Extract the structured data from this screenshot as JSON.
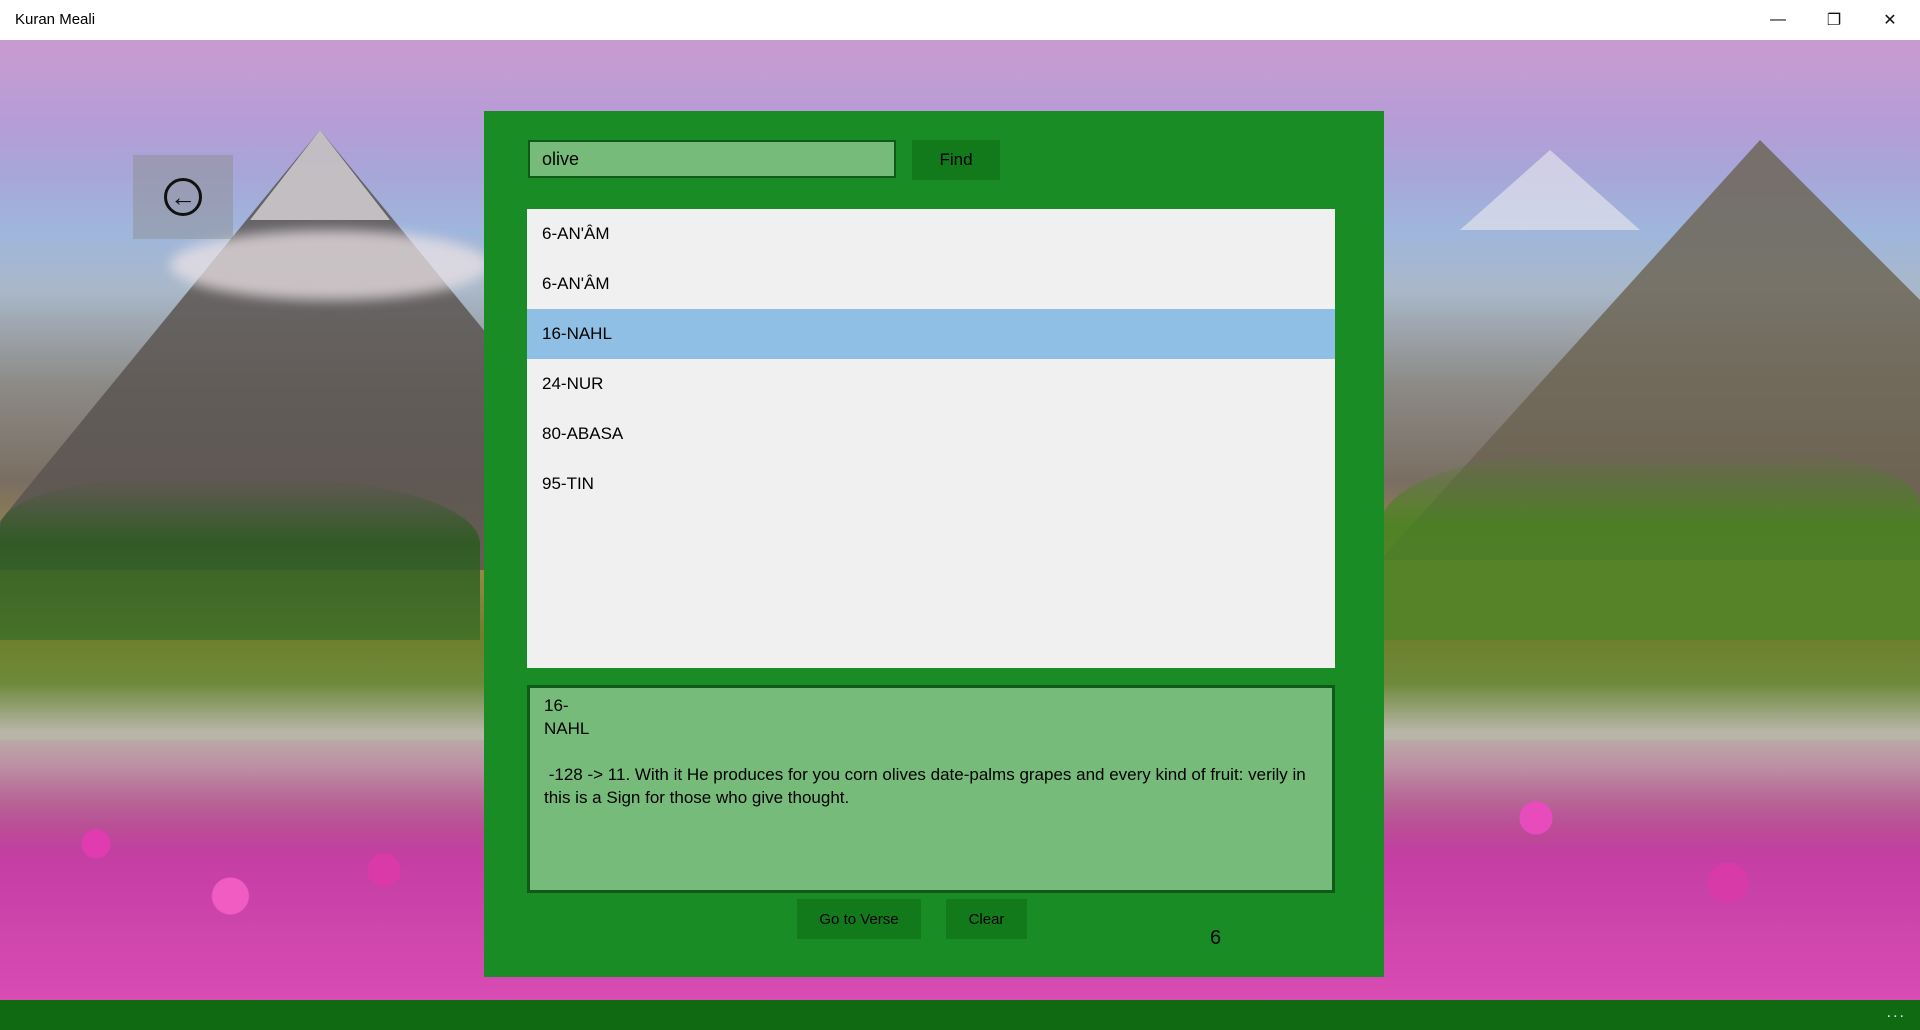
{
  "window": {
    "title": "Kuran Meali",
    "minimize_glyph": "—",
    "maximize_glyph": "❐",
    "close_glyph": "✕"
  },
  "back_button": {
    "icon": "back-arrow-icon",
    "glyph": "←"
  },
  "search": {
    "value": "olive",
    "find_label": "Find"
  },
  "results": {
    "items": [
      {
        "label": "6-AN'ÂM",
        "selected": false
      },
      {
        "label": "6-AN'ÂM",
        "selected": false
      },
      {
        "label": "16-NAHL",
        "selected": true
      },
      {
        "label": "24-NUR",
        "selected": false
      },
      {
        "label": "80-ABASA",
        "selected": false
      },
      {
        "label": "95-TIN",
        "selected": false
      }
    ]
  },
  "verse": {
    "text": "16-\nNAHL\n\n -128 -> 11. With it He produces for you corn olives date-palms grapes and every kind of fruit: verily in this is a Sign for those who give thought."
  },
  "actions": {
    "goto_label": "Go to Verse",
    "clear_label": "Clear"
  },
  "result_count": "6",
  "bottom_bar": {
    "more_glyph": "..."
  },
  "colors": {
    "panel": "#1a8c25",
    "button": "#137a1c",
    "input": "#77bb7a",
    "selected_item": "#8fbfe4",
    "list_bg": "#f0f0f0",
    "bottom_bar": "#0f6a12"
  }
}
